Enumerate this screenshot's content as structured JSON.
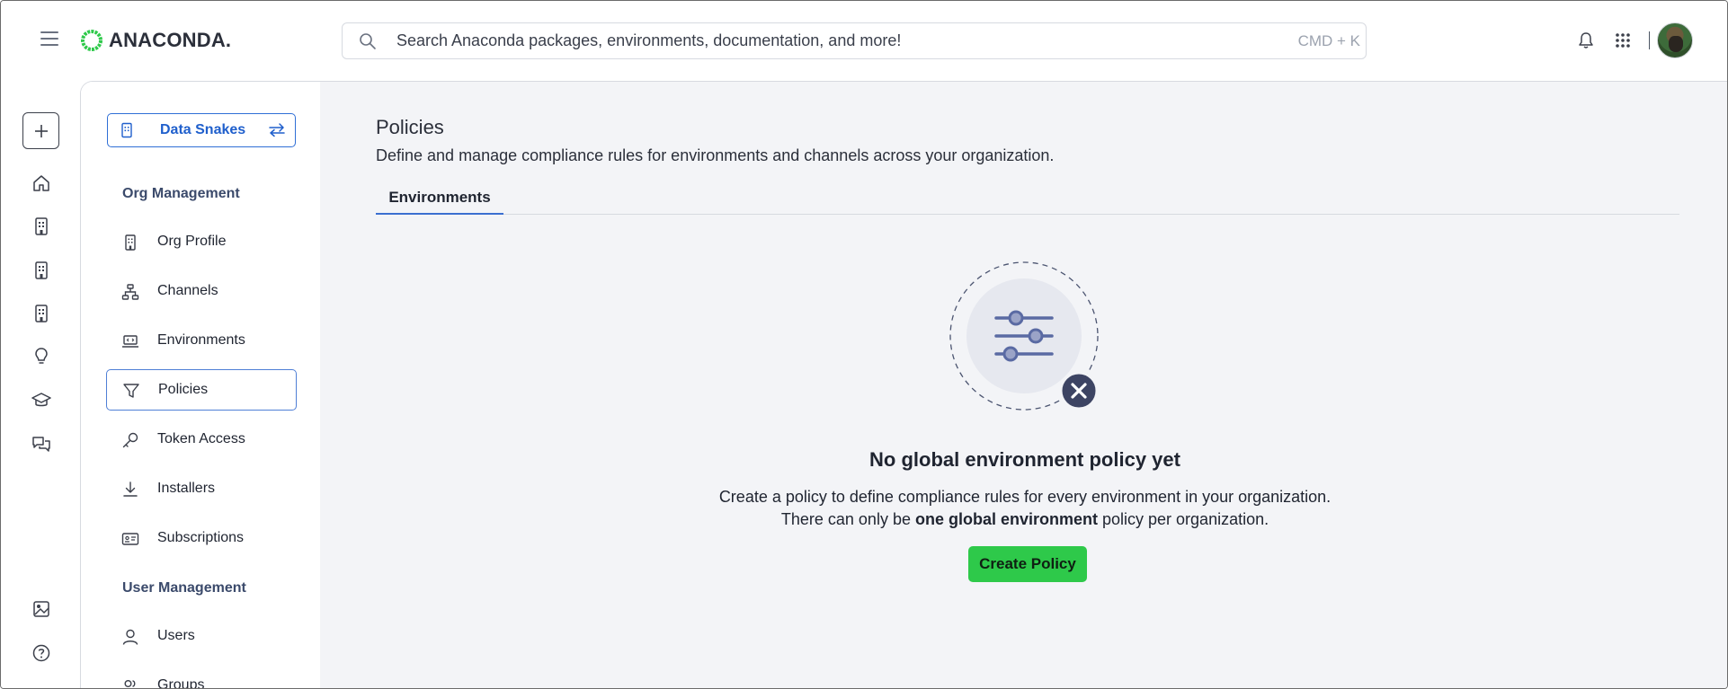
{
  "header": {
    "logo_text": "ANACONDA.",
    "search_placeholder": "Search Anaconda packages, environments, documentation, and more!",
    "search_shortcut": "CMD + K"
  },
  "sidebar": {
    "org_name": "Data Snakes",
    "sections": {
      "org": "Org Management",
      "user": "User Management"
    },
    "items": [
      {
        "label": "Org Profile",
        "icon": "building-icon"
      },
      {
        "label": "Channels",
        "icon": "network-icon"
      },
      {
        "label": "Environments",
        "icon": "laptop-code-icon"
      },
      {
        "label": "Policies",
        "icon": "filter-icon",
        "active": true
      },
      {
        "label": "Token Access",
        "icon": "key-icon"
      },
      {
        "label": "Installers",
        "icon": "download-icon"
      },
      {
        "label": "Subscriptions",
        "icon": "id-card-icon"
      },
      {
        "label": "Users",
        "icon": "user-icon"
      },
      {
        "label": "Groups",
        "icon": "users-icon"
      }
    ]
  },
  "main": {
    "title": "Policies",
    "description": "Define and manage compliance rules for environments and channels across your organization.",
    "tabs": [
      {
        "label": "Environments",
        "active": true
      }
    ],
    "empty_state": {
      "title": "No global environment policy yet",
      "line1": "Create a policy to define compliance rules for every environment in your organization.",
      "line2_prefix": "There can only be ",
      "line2_bold": "one global environment",
      "line2_suffix": " policy per organization.",
      "button": "Create Policy"
    }
  },
  "colors": {
    "accent": "#2f6fd6",
    "primary_button": "#2ec94a",
    "main_bg": "#f3f4f7",
    "logo_ring": "#2ec94a"
  }
}
